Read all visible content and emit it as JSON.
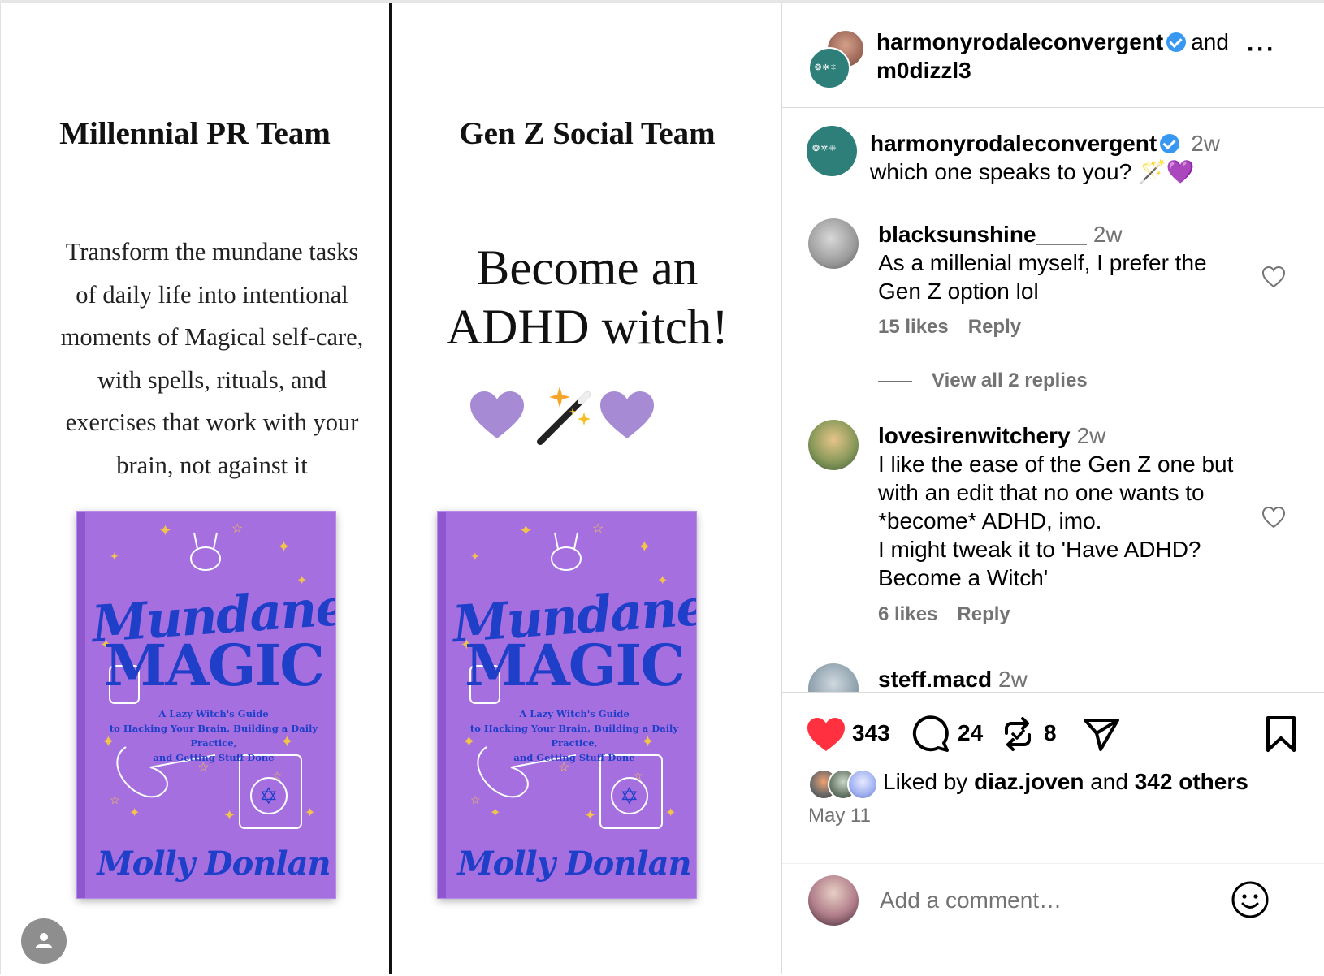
{
  "colors": {
    "book_purple": "#a66fe0",
    "book_blue": "#1f3fc9",
    "teal_avatar": "#2e7f7a",
    "heart_red": "#ff3040",
    "verified_blue": "#3897f0",
    "muted_text": "#737373"
  },
  "post": {
    "left_panel": {
      "heading": "Millennial PR Team",
      "body_lines": [
        "Transform the mundane tasks",
        "of daily life into intentional",
        "moments of Magical self-care,",
        "with spells, rituals, and",
        "exercises that work with your",
        "brain, not against it"
      ]
    },
    "right_panel": {
      "heading": "Gen Z Social Team",
      "big_lines": [
        "Become an",
        "ADHD witch!"
      ],
      "emoji": [
        "purple-heart",
        "magic-wand",
        "purple-heart"
      ]
    },
    "book": {
      "title_line1": "Mundane",
      "title_line2": "MAGIC",
      "subtitle_lines": [
        "A Lazy Witch's Guide",
        "to Hacking Your Brain, Building a Daily Practice,",
        "and Getting Stuff Done"
      ],
      "author": "Molly Donlan"
    },
    "user_icon": "person-icon"
  },
  "header": {
    "user1": "harmonyrodaleconvergent",
    "joiner": "and",
    "user2": "m0dizzl3",
    "more_icon": "more-horizontal-icon"
  },
  "caption": {
    "user": "harmonyrodaleconvergent",
    "time": "2w",
    "text": "which one speaks to you? 🪄💜"
  },
  "comments": [
    {
      "user": "blacksunshine____",
      "time": "2w",
      "lines": [
        "As a millenial myself, I prefer the",
        "Gen Z option lol"
      ],
      "likes": "15 likes",
      "reply": "Reply",
      "view_replies": "View all 2 replies"
    },
    {
      "user": "lovesirenwitchery",
      "time": "2w",
      "lines": [
        "I like the ease of the Gen Z one but",
        "with an edit that no one wants to",
        "*become* ADHD, imo.",
        "I might tweak it to 'Have ADHD?",
        "Become a Witch'"
      ],
      "likes": "6 likes",
      "reply": "Reply"
    },
    {
      "user": "steff.macd",
      "time": "2w"
    }
  ],
  "actions": {
    "like_count": "343",
    "comment_count": "24",
    "repost_count": "8",
    "liked_by_prefix": "Liked by",
    "liked_by_user": "diaz.joven",
    "liked_by_and": "and",
    "liked_by_others": "342 others",
    "date": "May 11"
  },
  "add_comment": {
    "placeholder": "Add a comment…"
  }
}
